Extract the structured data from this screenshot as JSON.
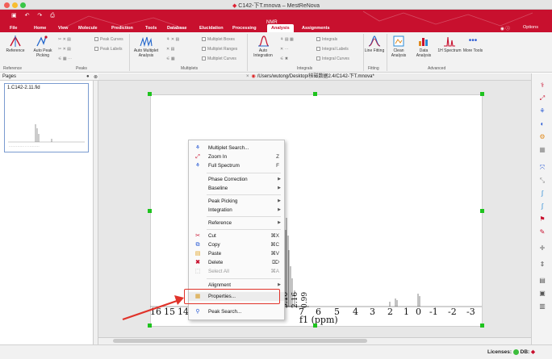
{
  "window": {
    "title_prefix": "C142-",
    "title_doc": "下",
    "title_rest": "T.mnova – MestReNova"
  },
  "ribbon": {
    "context_label": "NMR",
    "tabs": [
      "File",
      "Home",
      "View",
      "Molecule",
      "Prediction",
      "Tools",
      "Database",
      "Elucidation",
      "Processing",
      "Analysis",
      "Assignments"
    ],
    "active_tab": "Analysis",
    "right": {
      "options": "Options"
    },
    "buttons": {
      "reference": "Reference",
      "auto_peak_picking": "Auto Peak Picking",
      "auto_multiplet_analysis": "Auto Multiplet Analysis",
      "auto_integration": "Auto Integration",
      "line_fitting": "Line Fitting",
      "clean_analysis": "Clean Analysis",
      "data_analysis": "Data Analysis",
      "h1_spectrum": "1H Spectrum",
      "more_tools": "More Tools"
    },
    "small": {
      "peak_curves": "Peak Curves",
      "peak_labels": "Peak Labels",
      "multiplet_boxes": "Multiplet Boxes",
      "multiplet_ranges": "Multiplet Ranges",
      "multiplet_curves": "Multiplet Curves",
      "integrals": "Integrals",
      "integral_labels": "Integral Labels",
      "integral_curves": "Integral Curves"
    },
    "groups": {
      "reference": "Reference",
      "peaks": "Peaks",
      "multiplets": "Multiplets",
      "integrals": "Integrals",
      "fitting": "Fitting",
      "advanced": "Advanced"
    }
  },
  "pages": {
    "title": "Pages",
    "item_title": "1.C142-2.11.fid"
  },
  "document": {
    "tab_label": "/Users/wutong/Desktop/核磁数据2.4/C142-下T.mnova*"
  },
  "spectrum": {
    "x_ticks": [
      "16",
      "15",
      "14",
      "7",
      "6",
      "5",
      "4",
      "3",
      "2",
      "1",
      "0",
      "-1",
      "-2",
      "-3"
    ],
    "xlabel": "f1 (ppm)",
    "integrals": [
      "3.16",
      "2.16",
      "0.99"
    ]
  },
  "context_menu": {
    "items": [
      {
        "label": "Multiplet Search...",
        "shortcut": "",
        "icon": "multiplet-search-icon"
      },
      {
        "label": "Zoom In",
        "shortcut": "Z",
        "icon": "zoom-in-icon"
      },
      {
        "label": "Full Spectrum",
        "shortcut": "F",
        "icon": "full-spectrum-icon"
      },
      {
        "label": "Phase Correction",
        "submenu": true
      },
      {
        "label": "Baseline",
        "submenu": true
      },
      {
        "label": "Peak Picking",
        "submenu": true
      },
      {
        "label": "Integration",
        "submenu": true
      },
      {
        "label": "Reference",
        "submenu": true
      },
      {
        "label": "Cut",
        "shortcut": "⌘X",
        "icon": "scissors-icon"
      },
      {
        "label": "Copy",
        "shortcut": "⌘C",
        "icon": "copy-icon"
      },
      {
        "label": "Paste",
        "shortcut": "⌘V",
        "icon": "paste-icon"
      },
      {
        "label": "Delete",
        "shortcut": "⌦",
        "icon": "delete-icon"
      },
      {
        "label": "Select All",
        "shortcut": "⌘A",
        "icon": "select-all-icon",
        "disabled": true
      },
      {
        "label": "Alignment",
        "submenu": true
      },
      {
        "label": "Properties...",
        "icon": "properties-icon",
        "highlighted": true
      },
      {
        "label": "Peak Search...",
        "icon": "peak-search-icon"
      }
    ]
  },
  "status": {
    "licenses": "Licenses:",
    "db": "DB:"
  },
  "colors": {
    "brand_red": "#c8102e",
    "handle_green": "#1ec31e",
    "annotation_red": "#e0332a"
  }
}
